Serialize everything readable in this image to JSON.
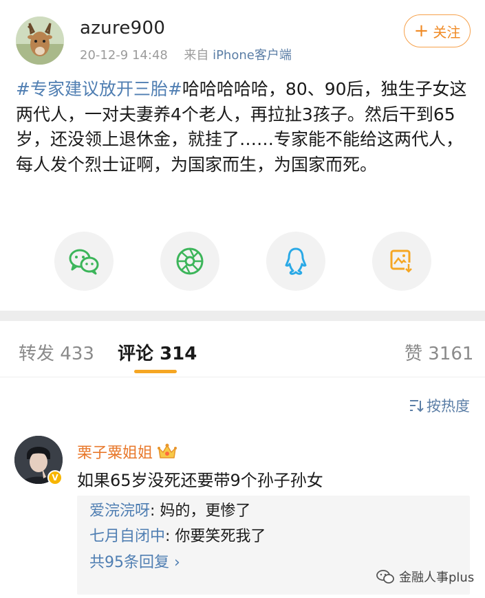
{
  "post": {
    "username": "azure900",
    "time": "20-12-9 14:48",
    "source_prefix": "来自 ",
    "source": "iPhone客户端",
    "follow_label": "关注",
    "topic": "#专家建议放开三胎#",
    "body": "哈哈哈哈哈，80、90后，独生子女这两代人，一对夫妻养4个老人，再拉扯3孩子。然后干到65岁，还没领上退休金，就挂了……专家能不能给这两代人，每人发个烈士证啊，为国家而生，为国家而死。"
  },
  "share": {
    "items": [
      {
        "icon": "wechat-icon"
      },
      {
        "icon": "moments-icon"
      },
      {
        "icon": "qq-icon"
      },
      {
        "icon": "save-image-icon"
      }
    ]
  },
  "tabs": {
    "repost_label": "转发",
    "repost_count": "433",
    "comment_label": "评论",
    "comment_count": "314",
    "like_label": "赞",
    "like_count": "3161"
  },
  "sort": {
    "label": "按热度"
  },
  "comment": {
    "name": "栗子粟姐姐",
    "text": "如果65岁没死还要带9个孙子孙女",
    "replies": [
      {
        "name": "爱浣浣呀",
        "text": ": 妈的，更惨了"
      },
      {
        "name": "七月自闭中",
        "text": ": 你要笑死我了"
      }
    ],
    "more_label": "共95条回复 ›"
  },
  "watermark": {
    "text": "金融人事plus"
  },
  "colors": {
    "accent_orange": "#f5a623",
    "link_blue": "#4f7eb2",
    "name_orange": "#e8782b"
  }
}
